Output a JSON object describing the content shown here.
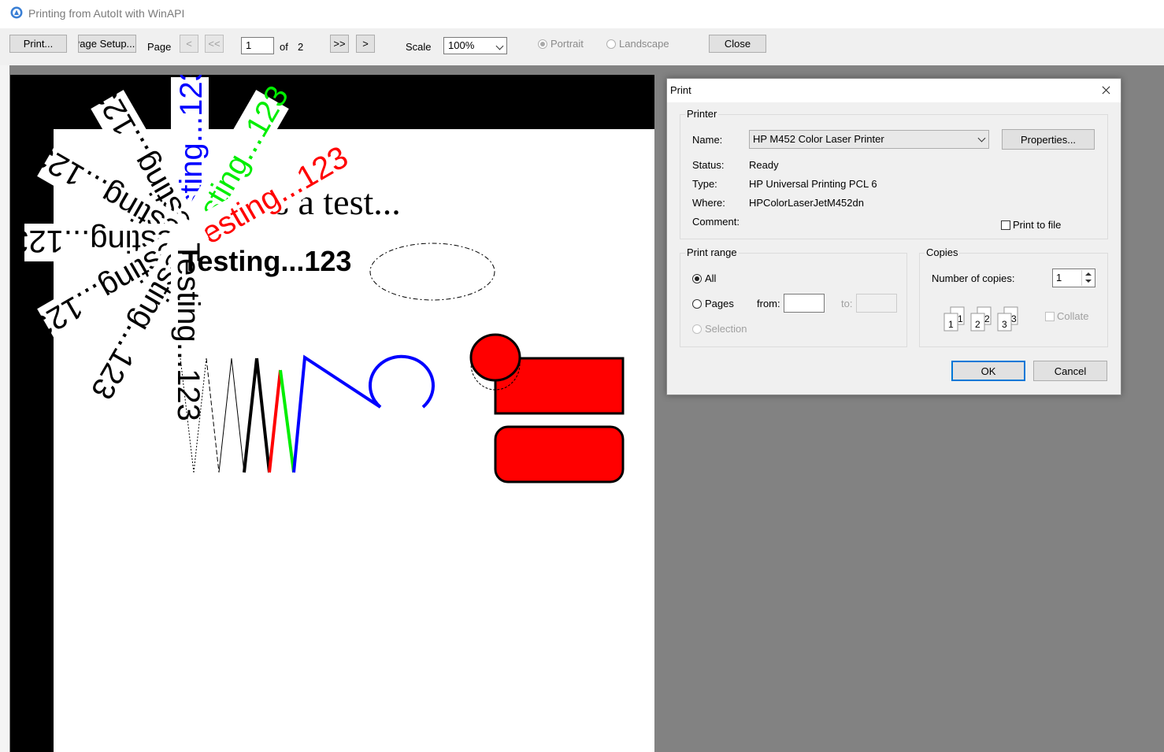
{
  "window": {
    "title": "Printing from AutoIt with WinAPI",
    "app_icon": "autoit-icon"
  },
  "toolbar": {
    "print_label": "Print...",
    "page_setup_label": "Page Setup...",
    "page_label": "Page",
    "prev_label": "<",
    "first_label": "<<",
    "page_value": "1",
    "of_label": "of",
    "total_pages": "2",
    "last_label": ">>",
    "next_label": ">",
    "scale_label": "Scale",
    "scale_value": "100%",
    "portrait_label": "Portrait",
    "landscape_label": "Landscape",
    "close_label": "Close"
  },
  "preview": {
    "heading_text": "This is a test...",
    "bold_text": "Testing...123",
    "rotated_text": "Testing...123",
    "colors": {
      "red": "#ff0000",
      "green": "#00ee00",
      "blue": "#0000ff",
      "black": "#000000"
    }
  },
  "print_dialog": {
    "title": "Print",
    "printer_group": "Printer",
    "name_label": "Name:",
    "printer_name": "HP M452 Color Laser Printer",
    "properties_label": "Properties...",
    "status_label": "Status:",
    "status_value": "Ready",
    "type_label": "Type:",
    "type_value": "HP Universal Printing PCL 6",
    "where_label": "Where:",
    "where_value": "HPColorLaserJetM452dn",
    "comment_label": "Comment:",
    "print_to_file_label": "Print to file",
    "print_range_group": "Print range",
    "all_label": "All",
    "pages_label": "Pages",
    "from_label": "from:",
    "to_label": "to:",
    "selection_label": "Selection",
    "copies_group": "Copies",
    "num_copies_label": "Number of copies:",
    "num_copies_value": "1",
    "collate_label": "Collate",
    "collate_pages": [
      "1",
      "1",
      "2",
      "2",
      "3",
      "3"
    ],
    "ok_label": "OK",
    "cancel_label": "Cancel"
  }
}
